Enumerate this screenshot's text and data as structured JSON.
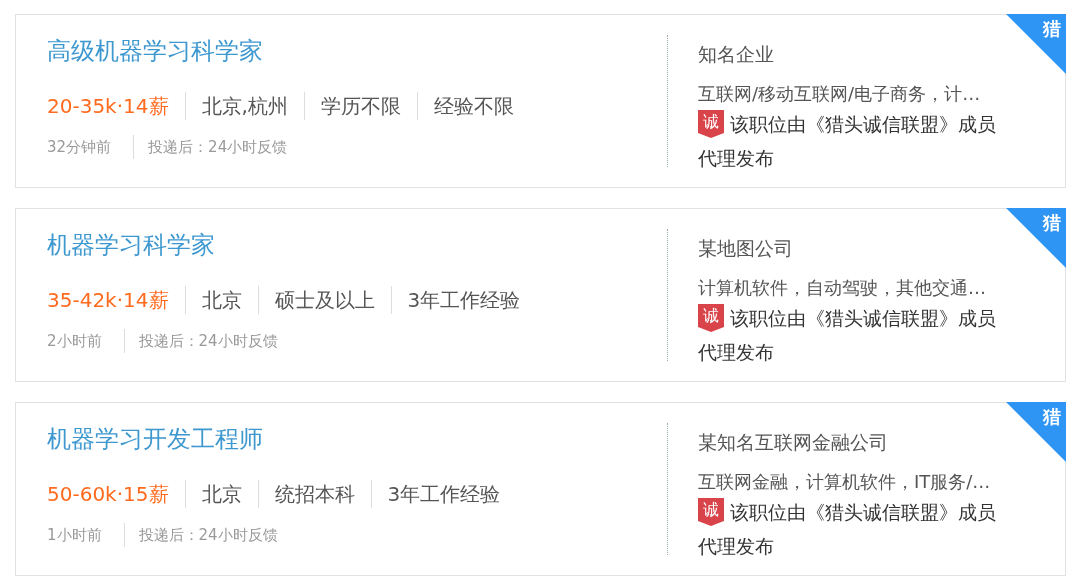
{
  "jobs": [
    {
      "title": "高级机器学习科学家",
      "salary": "20-35k·14薪",
      "tags": [
        "北京,杭州",
        "学历不限",
        "经验不限"
      ],
      "posted": "32分钟前",
      "feedback": "投递后：24小时反馈",
      "company": "知名企业",
      "industry": "互联网/移动互联网/电子商务，计…",
      "badge": "诚",
      "notice": [
        "该职位由《猎头诚信联盟》成员",
        "代理发布"
      ],
      "corner": "猎"
    },
    {
      "title": "机器学习科学家",
      "salary": "35-42k·14薪",
      "tags": [
        "北京",
        "硕士及以上",
        "3年工作经验"
      ],
      "posted": "2小时前",
      "feedback": "投递后：24小时反馈",
      "company": "某地图公司",
      "industry": "计算机软件，自动驾驶，其他交通…",
      "badge": "诚",
      "notice": [
        "该职位由《猎头诚信联盟》成员",
        "代理发布"
      ],
      "corner": "猎"
    },
    {
      "title": "机器学习开发工程师",
      "salary": "50-60k·15薪",
      "tags": [
        "北京",
        "统招本科",
        "3年工作经验"
      ],
      "posted": "1小时前",
      "feedback": "投递后：24小时反馈",
      "company": "某知名互联网金融公司",
      "industry": "互联网金融，计算机软件，IT服务/…",
      "badge": "诚",
      "notice": [
        "该职位由《猎头诚信联盟》成员",
        "代理发布"
      ],
      "corner": "猎"
    }
  ]
}
